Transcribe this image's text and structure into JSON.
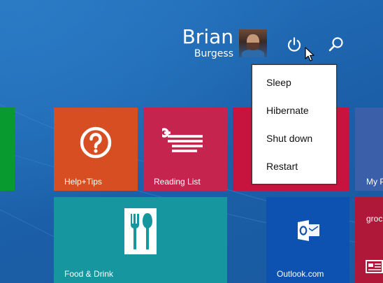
{
  "account": {
    "first_name": "Brian",
    "last_name": "Burgess"
  },
  "power_menu": {
    "items": [
      {
        "label": "Sleep"
      },
      {
        "label": "Hibernate"
      },
      {
        "label": "Shut down"
      },
      {
        "label": "Restart"
      }
    ]
  },
  "tiles": {
    "help": {
      "label": "Help+Tips",
      "icon": "question-icon",
      "color": "#d74e23"
    },
    "reading": {
      "label": "Reading List",
      "icon": "reading-list-icon",
      "color": "#c5244f"
    },
    "myp": {
      "label": "My P",
      "color": "#3b5fa8"
    },
    "food": {
      "label": "Food & Drink",
      "icon": "fork-knife-icon",
      "color": "#16979f"
    },
    "outlook": {
      "label": "Outlook.com",
      "icon": "outlook-icon",
      "color": "#0d52b0"
    },
    "groc": {
      "label": "groc",
      "icon": "news-icon",
      "color": "#b0183a"
    },
    "green": {
      "color": "#089a2e"
    }
  },
  "colors": {
    "background": "#1c63ae"
  }
}
